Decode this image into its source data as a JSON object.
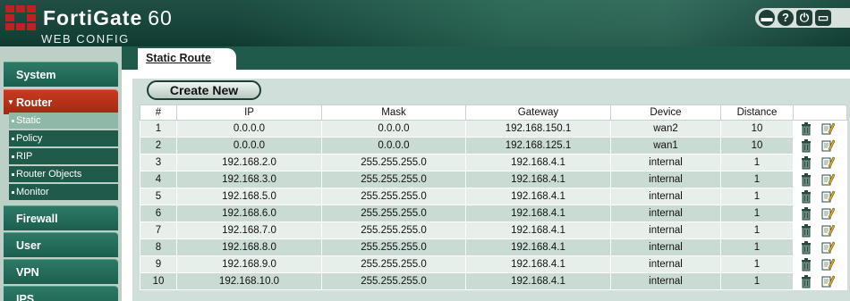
{
  "header": {
    "brand": "FortiGate",
    "model": "60",
    "subtitle": "WEB CONFIG",
    "icons": [
      "console-icon",
      "help-icon",
      "logout-icon",
      "fullscreen-icon"
    ]
  },
  "sidebar": {
    "sections": [
      {
        "label": "System",
        "active": false
      },
      {
        "label": "Router",
        "active": true
      },
      {
        "label": "Firewall",
        "active": false
      },
      {
        "label": "User",
        "active": false
      },
      {
        "label": "VPN",
        "active": false
      },
      {
        "label": "IPS",
        "active": false
      }
    ],
    "router_items": [
      {
        "label": "Static",
        "selected": true
      },
      {
        "label": "Policy",
        "selected": false
      },
      {
        "label": "RIP",
        "selected": false
      },
      {
        "label": "Router Objects",
        "selected": false
      },
      {
        "label": "Monitor",
        "selected": false
      }
    ]
  },
  "main": {
    "tab_label": "Static Route",
    "create_button": "Create New",
    "columns": [
      "#",
      "IP",
      "Mask",
      "Gateway",
      "Device",
      "Distance",
      ""
    ],
    "rows": [
      [
        "1",
        "0.0.0.0",
        "0.0.0.0",
        "192.168.150.1",
        "wan2",
        "10"
      ],
      [
        "2",
        "0.0.0.0",
        "0.0.0.0",
        "192.168.125.1",
        "wan1",
        "10"
      ],
      [
        "3",
        "192.168.2.0",
        "255.255.255.0",
        "192.168.4.1",
        "internal",
        "1"
      ],
      [
        "4",
        "192.168.3.0",
        "255.255.255.0",
        "192.168.4.1",
        "internal",
        "1"
      ],
      [
        "5",
        "192.168.5.0",
        "255.255.255.0",
        "192.168.4.1",
        "internal",
        "1"
      ],
      [
        "6",
        "192.168.6.0",
        "255.255.255.0",
        "192.168.4.1",
        "internal",
        "1"
      ],
      [
        "7",
        "192.168.7.0",
        "255.255.255.0",
        "192.168.4.1",
        "internal",
        "1"
      ],
      [
        "8",
        "192.168.8.0",
        "255.255.255.0",
        "192.168.4.1",
        "internal",
        "1"
      ],
      [
        "9",
        "192.168.9.0",
        "255.255.255.0",
        "192.168.4.1",
        "internal",
        "1"
      ],
      [
        "10",
        "192.168.10.0",
        "255.255.255.0",
        "192.168.4.1",
        "internal",
        "1"
      ]
    ]
  },
  "colors": {
    "header_green": "#1f4f44",
    "active_section_red": "#c83a1e",
    "row_light": "#e6efea",
    "row_dark": "#cadbd4"
  }
}
